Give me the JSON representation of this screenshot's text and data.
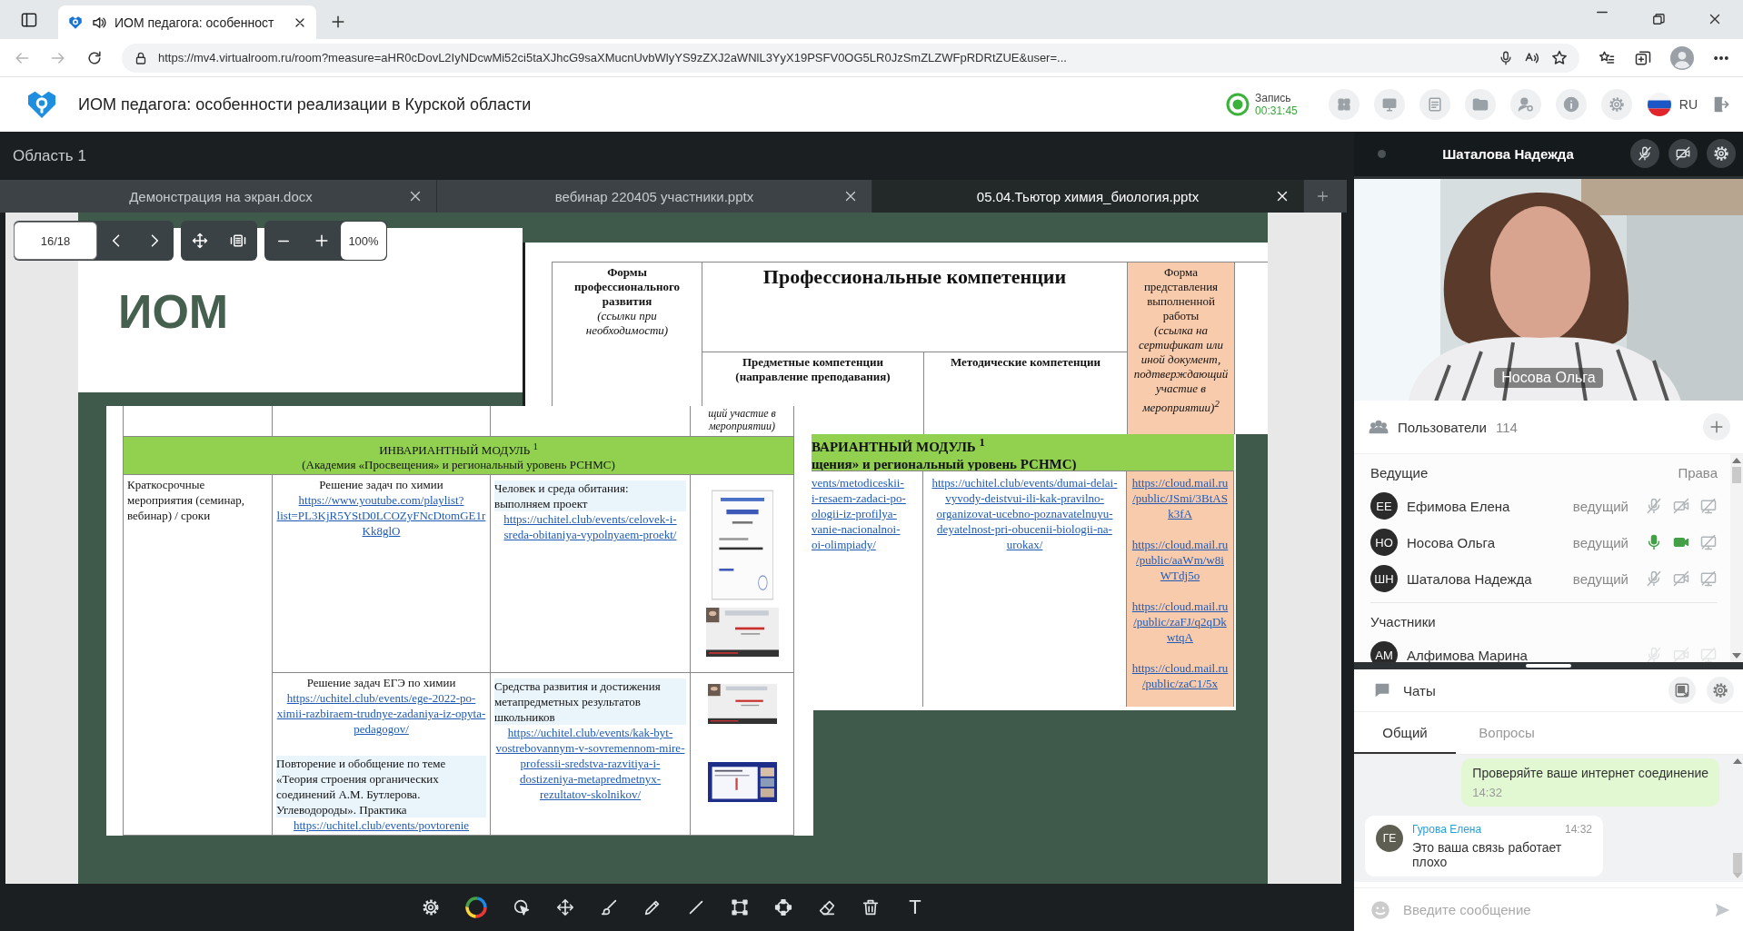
{
  "browser": {
    "tab_title": "ИОМ педагога: особенност",
    "url": "https://mv4.virtualroom.ru/room?measure=aHR0cDovL2IyNDcwMi52ci5taXJhcG9saXMucnUvbWlyYS9zZXJ2aWNlL3YyX19PSFV0OG5LR0JzSmZLZWFpRDRtZUE&user=..."
  },
  "header": {
    "title": "ИОМ педагога: особенности реализации в Курской области",
    "recording": {
      "label": "Запись",
      "time": "00:31:45",
      "on": true
    },
    "language": "RU"
  },
  "area": {
    "title": "Область 1"
  },
  "doc_tabs": [
    {
      "label": "Демонстрация на экран.docx",
      "selected": false
    },
    {
      "label": "вебинар 220405 участники.pptx",
      "selected": false
    },
    {
      "label": "05.04.Тьютор химия_биология.pptx",
      "selected": true
    }
  ],
  "viewer": {
    "page": "16/18",
    "zoom": "100%"
  },
  "slide": {
    "title": "ИОМ",
    "header_table": {
      "forms_title": "Формы профессионального развития",
      "forms_note": "(ссылки при необходимости)",
      "competences_title": "Профессиональные компетенции",
      "subject_title": "Предметные компетенции (направление преподавания)",
      "method_title": "Методические компетенции",
      "result_title": "Форма представления выполненной работы",
      "result_note": "(ссылка на сертификат или иной документ, подтверждающий участие в мероприятии)$^{2}$"
    },
    "left_table": {
      "top_note": "щий участие в мероприятии)",
      "module_title": "ИНВАРИАНТНЫЙ МОДУЛЬ $^{1}$",
      "module_subtitle": "(Академия «Просвещения» и региональный уровень РСНМС)",
      "row_label": "Краткосрочные мероприятия (семинар, вебинар) / сроки",
      "rows": [
        {
          "subject": [
            {
              "kind": "title",
              "text": "Решение задач по химии"
            },
            {
              "kind": "link",
              "text": "https://www.youtube.com/playlist?list=PL3KjR5YStD0LCOZyFNcDtomGE1rKk8glO"
            }
          ],
          "method": [
            {
              "kind": "highlight",
              "text": "Человек и среда обитания: выполняем проект"
            },
            {
              "kind": "link",
              "text": "https://uchitel.club/events/celovek-i-sreda-obitaniya-vypolnyaem-proekt/"
            }
          ],
          "results": [
            {
              "kind": "picture"
            },
            {
              "kind": "picture"
            }
          ]
        },
        {
          "subject": [
            {
              "kind": "title",
              "text": "Решение задач ЕГЭ по химии"
            },
            {
              "kind": "link",
              "text": "https://uchitel.club/events/ege-2022-po-ximii-razbiraem-trudnye-zadaniya-iz-opyta-pedagogov/"
            },
            {
              "kind": "highlight",
              "text": "Повторение и обобщение по теме «Теория строения органических соединений А.М. Бутлерова. Углеводороды». Практика"
            },
            {
              "kind": "link",
              "text": "https://uchitel.club/events/povtorenie"
            }
          ],
          "method": [
            {
              "kind": "highlight",
              "text": "Средства развития и достижения метапредметных результатов школьников"
            },
            {
              "kind": "link",
              "text": "https://uchitel.club/events/kak-byt-vostrebovannym-v-sovremennom-mire-professii-sredstva-razvitiya-i-dostizeniya-metapredmetnyx-rezultatov-skolnikov/"
            }
          ],
          "results": [
            {
              "kind": "picture"
            },
            {
              "kind": "picture"
            }
          ]
        }
      ]
    },
    "right_table": {
      "module_title": "ВАРИАНТНЫЙ МОДУЛЬ $^{1}$",
      "module_subtitle": "щения» и региональный уровень РСНМС)",
      "subject_link": "vents/metodiceskii-\ni-resaem-zadaci-po-\nologii-iz-profilya-\nvanie-nacionalnoi-\noi-olimpiady/",
      "method_link": "https://uchitel.club/events/dumai-delai-vyvody-deistvui-ili-kak-pravilno-organizovat-ucebno-poznavatelnuyu-deyatelnost-pri-obucenii-biologii-na-urokax/",
      "result_links": [
        "https://cloud.mail.ru/public/JSmi/3BtASk3fA",
        "https://cloud.mail.ru/public/aaWm/w8iWTdj5o",
        "https://cloud.mail.ru/public/zaFJ/q2qDkwtqA",
        "https://cloud.mail.ru/public/zaC1/5x"
      ]
    }
  },
  "toolbar": {
    "text_tool": "T"
  },
  "speaker": {
    "name": "Шаталова Надежда",
    "video_label": "Носова Ольга"
  },
  "users": {
    "title": "Пользователи",
    "count": "114",
    "hosts_title": "Ведущие",
    "rights_title": "Права",
    "hosts": [
      {
        "initials": "ЕЕ",
        "name": "Ефимова Елена",
        "role": "ведущий",
        "mic_on": false,
        "camera_on": false
      },
      {
        "initials": "НО",
        "name": "Носова Ольга",
        "role": "ведущий",
        "mic_on": true,
        "camera_on": true
      },
      {
        "initials": "ШН",
        "name": "Шаталова Надежда",
        "role": "ведущий",
        "mic_on": false,
        "camera_on": false
      }
    ],
    "participants_title": "Участники",
    "participants": [
      {
        "initials": "АМ",
        "name": "Алфимова Марина",
        "mic_on": false,
        "camera_on": false
      }
    ]
  },
  "chat": {
    "title": "Чаты",
    "tabs": [
      {
        "label": "Общий",
        "selected": true
      },
      {
        "label": "Вопросы",
        "selected": false
      }
    ],
    "messages": [
      {
        "kind": "own",
        "text": "Проверяйте ваше интернет соединение",
        "time": "14:32"
      },
      {
        "kind": "incoming",
        "initials": "ГЕ",
        "author": "Гурова Елена",
        "time": "14:32",
        "text": "Это ваша связь работает плохо"
      }
    ],
    "input": {
      "placeholder": "Введите сообщение"
    }
  }
}
